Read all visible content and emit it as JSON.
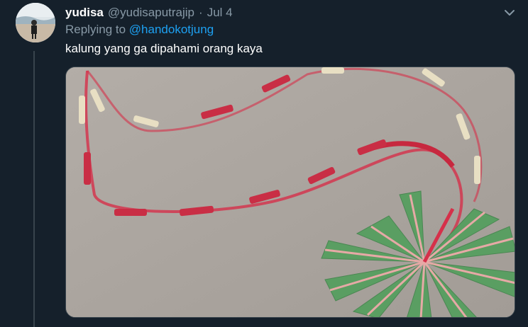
{
  "tweet": {
    "display_name": "yudisa",
    "handle": "@yudisaputrajip",
    "separator": "·",
    "time": "Jul 4",
    "replying_prefix": "Replying to",
    "replying_to": "@handokotjung",
    "text": "kalung yang ga dipahami orang kaya"
  },
  "icons": {
    "menu": "chevron-down-icon",
    "avatar": "avatar"
  },
  "colors": {
    "background": "#15202b",
    "secondary_text": "#8899a6",
    "link": "#1da1f2",
    "necklace": "#d6304a",
    "leaf": "#5a9e62"
  }
}
